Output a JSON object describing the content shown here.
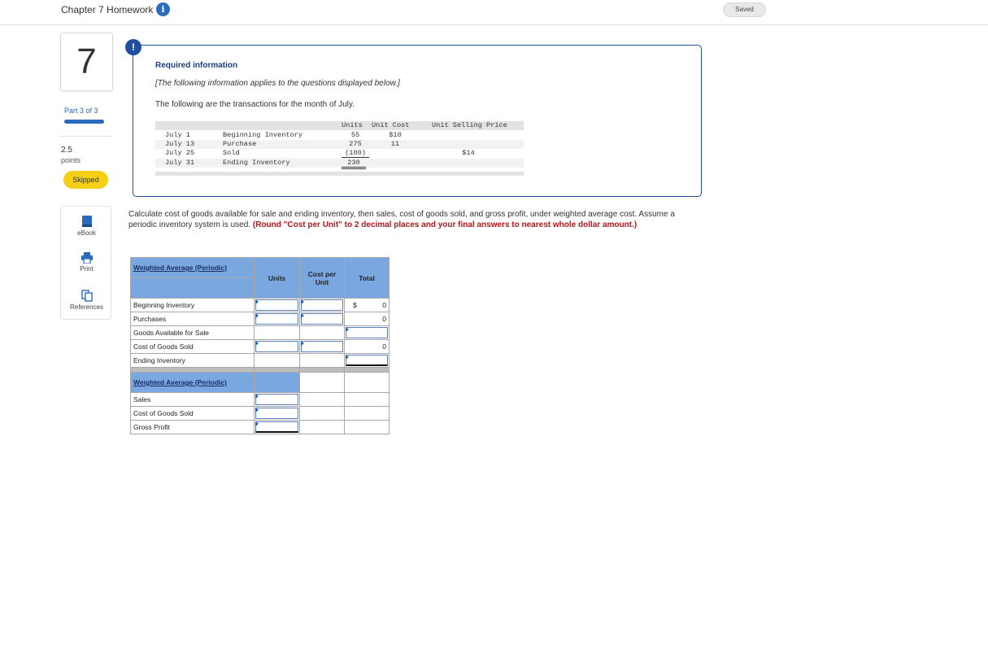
{
  "header": {
    "title": "Chapter 7 Homework",
    "info_icon": "i",
    "saved_label": "Saved"
  },
  "rail": {
    "question_number": "7",
    "part": "Part 3 of 3",
    "points_value": "2.5",
    "points_label": "points",
    "status": "Skipped",
    "tools": [
      {
        "label": "eBook",
        "icon": "book-icon"
      },
      {
        "label": "Print",
        "icon": "printer-icon"
      },
      {
        "label": "References",
        "icon": "copy-icon"
      }
    ]
  },
  "required": {
    "badge": "!",
    "title": "Required information",
    "note": "[The following information applies to the questions displayed below.]",
    "lead": "The following are the transactions for the month of July.",
    "headers": {
      "units": "Units",
      "unit_cost": "Unit Cost",
      "unit_selling_price": "Unit Selling Price"
    },
    "rows": [
      {
        "date": "July 1",
        "desc": "Beginning Inventory",
        "units": "55",
        "cost": "$10",
        "price": ""
      },
      {
        "date": "July 13",
        "desc": "Purchase",
        "units": "275",
        "cost": "11",
        "price": ""
      },
      {
        "date": "July 25",
        "desc": "Sold",
        "units": "(100)",
        "cost": "",
        "price": "$14"
      },
      {
        "date": "July 31",
        "desc": "Ending Inventory",
        "units": "230",
        "cost": "",
        "price": ""
      }
    ]
  },
  "question": {
    "text": "Calculate cost of goods available for sale and ending inventory, then sales, cost of goods sold, and gross profit, under weighted average cost. Assume a periodic inventory system is used.",
    "emphasis": "(Round \"Cost per Unit\" to 2 decimal places and your final answers to nearest whole dollar amount.)"
  },
  "table1": {
    "title": "Weighted Average (Periodic)",
    "col_units": "Units",
    "col_cost": "Cost per Unit",
    "col_total": "Total",
    "rows": [
      {
        "label": "Beginning Inventory",
        "dollar": "$",
        "total": "0"
      },
      {
        "label": "Purchases",
        "dollar": "",
        "total": "0"
      },
      {
        "label": "Goods Available for Sale",
        "dollar": "",
        "total": ""
      },
      {
        "label": "Cost of Goods Sold",
        "dollar": "",
        "total": "0"
      },
      {
        "label": "Ending Inventory",
        "dollar": "",
        "total": ""
      }
    ]
  },
  "table2": {
    "title": "Weighted Average (Periodic)",
    "rows": [
      {
        "label": "Sales"
      },
      {
        "label": "Cost of Goods Sold"
      },
      {
        "label": "Gross Profit"
      }
    ]
  }
}
